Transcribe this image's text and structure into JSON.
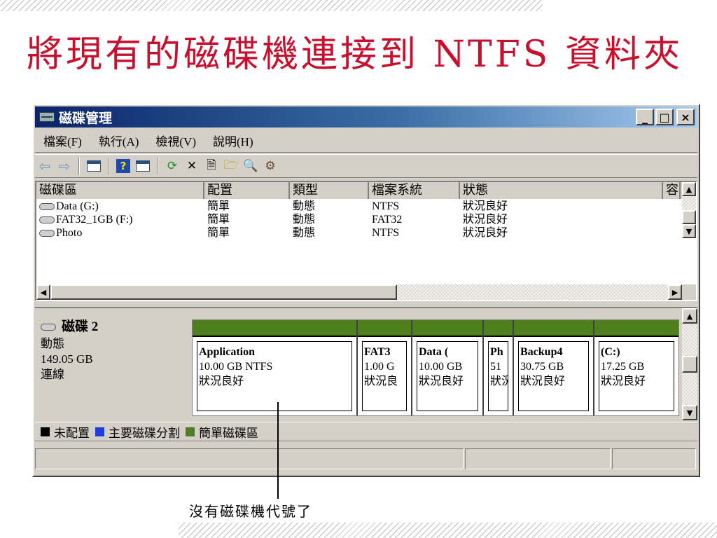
{
  "slide": {
    "title": "將現有的磁碟機連接到 NTFS 資料夾",
    "callout": "沒有磁碟機代號了"
  },
  "window": {
    "title": "磁碟管理",
    "buttons": {
      "minimize": "_",
      "maximize": "□",
      "close": "×"
    }
  },
  "menu": [
    "檔案(F)",
    "執行(A)",
    "檢視(V)",
    "說明(H)"
  ],
  "toolbar": [
    "back-arrow-icon",
    "forward-arrow-icon",
    "window-icon",
    "help-icon",
    "window-icon",
    "refresh-icon",
    "delete-icon",
    "properties-icon",
    "open-folder-icon",
    "search-icon",
    "settings-icon"
  ],
  "volume_list": {
    "headers": [
      "磁碟區",
      "配置",
      "類型",
      "檔案系統",
      "狀態",
      "容"
    ],
    "rows": [
      {
        "volume": "Data (G:)",
        "layout": "簡單",
        "type": "動態",
        "fs": "NTFS",
        "status": "狀況良好"
      },
      {
        "volume": "FAT32_1GB (F:)",
        "layout": "簡單",
        "type": "動態",
        "fs": "FAT32",
        "status": "狀況良好"
      },
      {
        "volume": "Photo",
        "layout": "簡單",
        "type": "動態",
        "fs": "NTFS",
        "status": "狀況良好"
      }
    ]
  },
  "disk": {
    "name": "磁碟 2",
    "type": "動態",
    "size": "149.05 GB",
    "state": "連線",
    "partitions": [
      {
        "name": "Application",
        "detail": "10.00 GB NTFS",
        "status": "狀況良好"
      },
      {
        "name": "FAT3",
        "detail": "1.00 G",
        "status": "狀況良"
      },
      {
        "name": "Data (",
        "detail": "10.00 GB",
        "status": "狀況良好"
      },
      {
        "name": "Ph",
        "detail": "51",
        "status": "狀況"
      },
      {
        "name": "Backup4",
        "detail": "30.75 GB",
        "status": "狀況良好"
      },
      {
        "name": "(C:)",
        "detail": "17.25 GB",
        "status": "狀況良好"
      }
    ]
  },
  "legend": [
    {
      "label": "未配置",
      "color": "#000000"
    },
    {
      "label": "主要磁碟分割",
      "color": "#1c3fd6"
    },
    {
      "label": "簡單磁碟區",
      "color": "#4f7f1c"
    }
  ]
}
